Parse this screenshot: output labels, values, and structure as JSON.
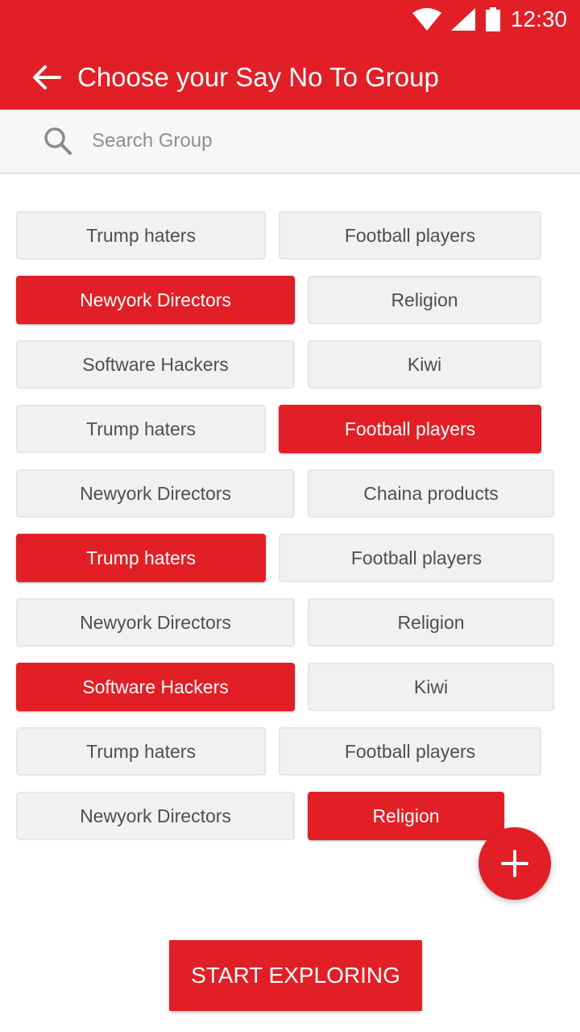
{
  "status_bar": {
    "time": "12:30",
    "icons": [
      "wifi-icon",
      "signal-icon",
      "battery-icon"
    ]
  },
  "header": {
    "title": "Choose your Say No To Group",
    "back_icon": "arrow-left-icon"
  },
  "search": {
    "placeholder": "Search Group",
    "value": ""
  },
  "groups": [
    {
      "label": "Trump haters",
      "selected": false
    },
    {
      "label": "Football players",
      "selected": false
    },
    {
      "label": "Newyork Directors",
      "selected": true
    },
    {
      "label": "Religion",
      "selected": false
    },
    {
      "label": "Software Hackers",
      "selected": false
    },
    {
      "label": "Kiwi",
      "selected": false
    },
    {
      "label": "Trump haters",
      "selected": false
    },
    {
      "label": "Football players",
      "selected": true
    },
    {
      "label": "Newyork Directors",
      "selected": false
    },
    {
      "label": "Chaina products",
      "selected": false
    },
    {
      "label": "Trump haters",
      "selected": true
    },
    {
      "label": "Football players",
      "selected": false
    },
    {
      "label": "Newyork Directors",
      "selected": false
    },
    {
      "label": "Religion",
      "selected": false
    },
    {
      "label": "Software Hackers",
      "selected": true
    },
    {
      "label": "Kiwi",
      "selected": false
    },
    {
      "label": "Trump haters",
      "selected": false
    },
    {
      "label": "Football players",
      "selected": false
    },
    {
      "label": "Newyork Directors",
      "selected": false
    },
    {
      "label": "Religion",
      "selected": true
    }
  ],
  "fab": {
    "icon": "plus-icon"
  },
  "cta": {
    "label": "START EXPLORING"
  },
  "colors": {
    "primary": "#e21f26",
    "chip_bg": "#f1f1f1",
    "chip_text": "#4f4f4f"
  }
}
